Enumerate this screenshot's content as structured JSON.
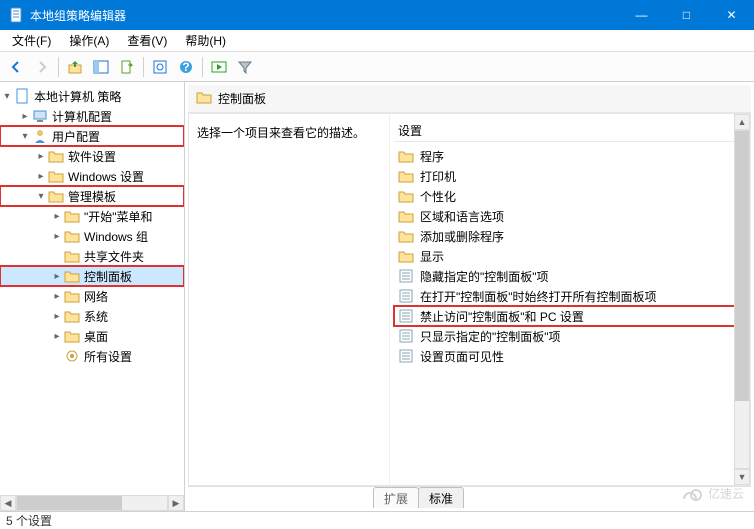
{
  "window": {
    "title": "本地组策略编辑器",
    "min": "—",
    "max": "□",
    "close": "✕"
  },
  "menu": {
    "file": "文件(F)",
    "action": "操作(A)",
    "view": "查看(V)",
    "help": "帮助(H)"
  },
  "tree": {
    "root": "本地计算机 策略",
    "computer_cfg": "计算机配置",
    "user_cfg": "用户配置",
    "soft": "软件设置",
    "win_set": "Windows 设置",
    "admin_tpl": "管理模板",
    "start": "\"开始\"菜单和",
    "win_comp": "Windows 组",
    "shared": "共享文件夹",
    "ctrl_panel": "控制面板",
    "network": "网络",
    "system": "系统",
    "desktop": "桌面",
    "all": "所有设置"
  },
  "header": {
    "path": "控制面板"
  },
  "desc": {
    "hint": "选择一个项目来查看它的描述。"
  },
  "list": {
    "col_setting": "设置",
    "items": [
      {
        "t": "folder",
        "label": "程序"
      },
      {
        "t": "folder",
        "label": "打印机"
      },
      {
        "t": "folder",
        "label": "个性化"
      },
      {
        "t": "folder",
        "label": "区域和语言选项"
      },
      {
        "t": "folder",
        "label": "添加或删除程序"
      },
      {
        "t": "folder",
        "label": "显示"
      },
      {
        "t": "setting",
        "label": "隐藏指定的\"控制面板\"项"
      },
      {
        "t": "setting",
        "label": "在打开\"控制面板\"时始终打开所有控制面板项"
      },
      {
        "t": "setting",
        "label": "禁止访问\"控制面板\"和 PC 设置",
        "hl": true
      },
      {
        "t": "setting",
        "label": "只显示指定的\"控制面板\"项"
      },
      {
        "t": "setting",
        "label": "设置页面可见性"
      }
    ]
  },
  "tabs": {
    "ext": "扩展",
    "std": "标准"
  },
  "status": {
    "count": "5 个设置"
  },
  "watermark": "亿速云"
}
